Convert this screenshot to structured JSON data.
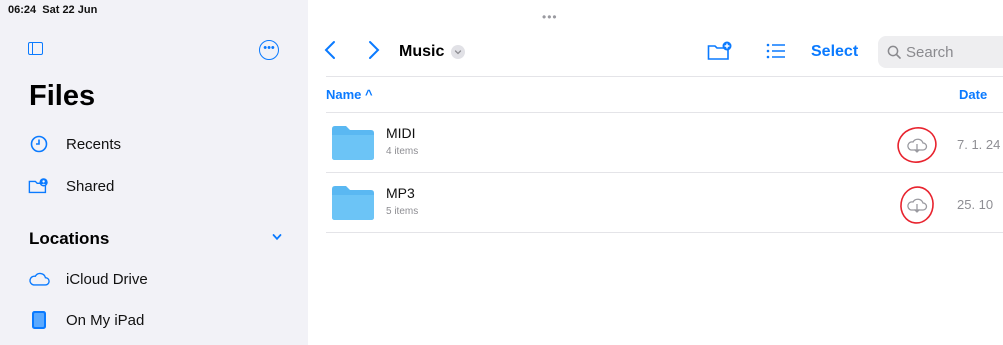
{
  "status": {
    "time": "06:24",
    "date": "Sat 22 Jun"
  },
  "sidebar": {
    "title": "Files",
    "items": [
      {
        "label": "Recents",
        "icon": "clock-icon"
      },
      {
        "label": "Shared",
        "icon": "shared-folder-icon"
      }
    ],
    "locations": {
      "label": "Locations",
      "items": [
        {
          "label": "iCloud Drive",
          "icon": "cloud-icon"
        },
        {
          "label": "On My iPad",
          "icon": "ipad-icon"
        }
      ]
    }
  },
  "toolbar": {
    "folder_title": "Music",
    "select_label": "Select",
    "search_placeholder": "Search"
  },
  "list": {
    "columns": {
      "name": "Name ^",
      "date": "Date"
    },
    "rows": [
      {
        "name": "MIDI",
        "count": "4 items",
        "date": "7. 1. 24"
      },
      {
        "name": "MP3",
        "count": "5 items",
        "date": "25. 10"
      }
    ]
  },
  "colors": {
    "accent": "#0a7aff",
    "folder": "#5ab8f2",
    "annotation": "#e8232e"
  }
}
